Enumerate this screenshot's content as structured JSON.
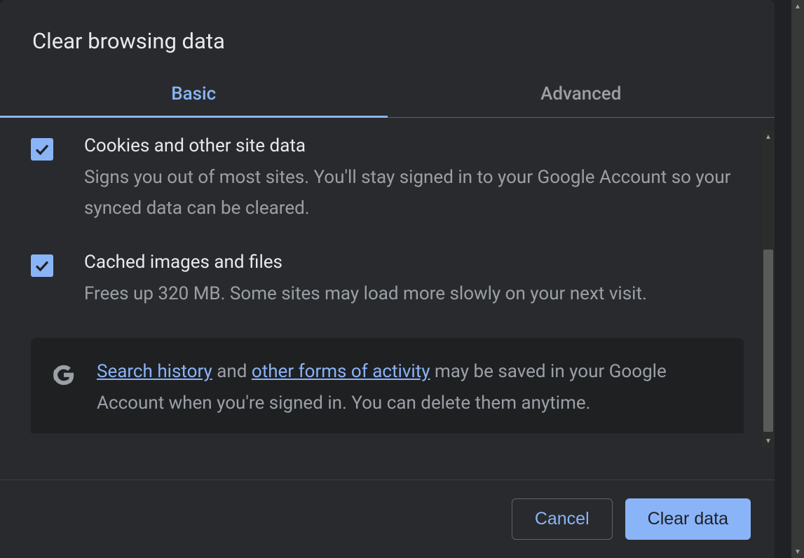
{
  "dialog": {
    "title": "Clear browsing data"
  },
  "tabs": {
    "basic": "Basic",
    "advanced": "Advanced"
  },
  "options": {
    "cookies": {
      "title": "Cookies and other site data",
      "desc": "Signs you out of most sites. You'll stay signed in to your Google Account so your synced data can be cleared."
    },
    "cache": {
      "title": "Cached images and files",
      "desc": "Frees up 320 MB. Some sites may load more slowly on your next visit."
    }
  },
  "info": {
    "link1": "Search history",
    "mid1": " and ",
    "link2": "other forms of activity",
    "rest": " may be saved in your Google Account when you're signed in. You can delete them anytime."
  },
  "footer": {
    "cancel": "Cancel",
    "clear": "Clear data"
  }
}
